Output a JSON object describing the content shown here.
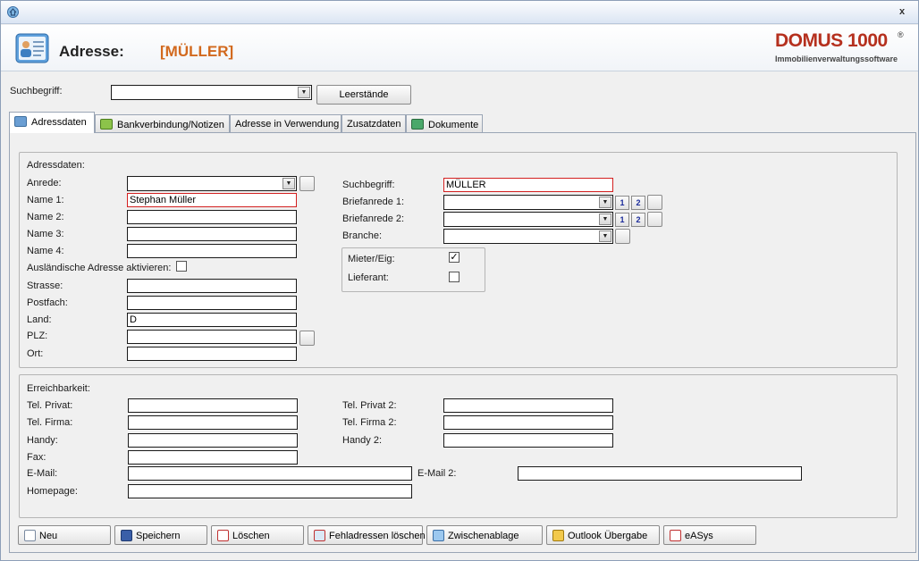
{
  "window": {
    "close_glyph": "x"
  },
  "header": {
    "title": "Adresse:",
    "name": "[MÜLLER]",
    "brand": "DOMUS 1000",
    "brand_reg": "®",
    "brand_sub": "Immobilienverwaltungssoftware"
  },
  "search": {
    "label": "Suchbegriff:",
    "value": "",
    "leerstaende": "Leerstände"
  },
  "tabs": [
    {
      "label": "Adressdaten",
      "icon": "address-card-icon"
    },
    {
      "label": "Bankverbindung/Notizen",
      "icon": "money-icon"
    },
    {
      "label": "Adresse in Verwendung",
      "icon": ""
    },
    {
      "label": "Zusatzdaten",
      "icon": ""
    },
    {
      "label": "Dokumente",
      "icon": "documents-icon"
    }
  ],
  "address": {
    "group_label": "Adressdaten:",
    "anrede_label": "Anrede:",
    "anrede_value": "",
    "name1_label": "Name 1:",
    "name1_value": "Stephan Müller",
    "name2_label": "Name 2:",
    "name2_value": "",
    "name3_label": "Name 3:",
    "name3_value": "",
    "name4_label": "Name 4:",
    "name4_value": "",
    "foreign_label": "Ausländische Adresse aktivieren:",
    "strasse_label": "Strasse:",
    "strasse_value": "",
    "postfach_label": "Postfach:",
    "postfach_value": "",
    "land_label": "Land:",
    "land_value": "D",
    "plz_label": "PLZ:",
    "plz_value": "",
    "ort_label": "Ort:",
    "ort_value": "",
    "suchbegriff_label": "Suchbegriff:",
    "suchbegriff_value": "MÜLLER",
    "briefanrede1_label": "Briefanrede 1:",
    "briefanrede2_label": "Briefanrede 2:",
    "branche_label": "Branche:",
    "btn1": "1",
    "btn2": "2",
    "mieter_label": "Mieter/Eig:",
    "mieter_checked": true,
    "lieferant_label": "Lieferant:",
    "lieferant_checked": false
  },
  "contact": {
    "group_label": "Erreichbarkeit:",
    "tel_privat_label": "Tel. Privat:",
    "tel_firma_label": "Tel. Firma:",
    "handy_label": "Handy:",
    "fax_label": "Fax:",
    "email_label": "E-Mail:",
    "homepage_label": "Homepage:",
    "tel_privat2_label": "Tel. Privat 2:",
    "tel_firma2_label": "Tel. Firma 2:",
    "handy2_label": "Handy 2:",
    "email2_label": "E-Mail 2:"
  },
  "buttons": {
    "neu": "Neu",
    "speichern": "Speichern",
    "loeschen": "Löschen",
    "fehladressen": "Fehladressen löschen",
    "zwischenablage": "Zwischenablage",
    "outlook": "Outlook Übergabe",
    "easys": "eASys"
  },
  "colors": {
    "accent_orange": "#d2691e",
    "brand_red": "#b5301e",
    "required_border": "#d32020"
  }
}
